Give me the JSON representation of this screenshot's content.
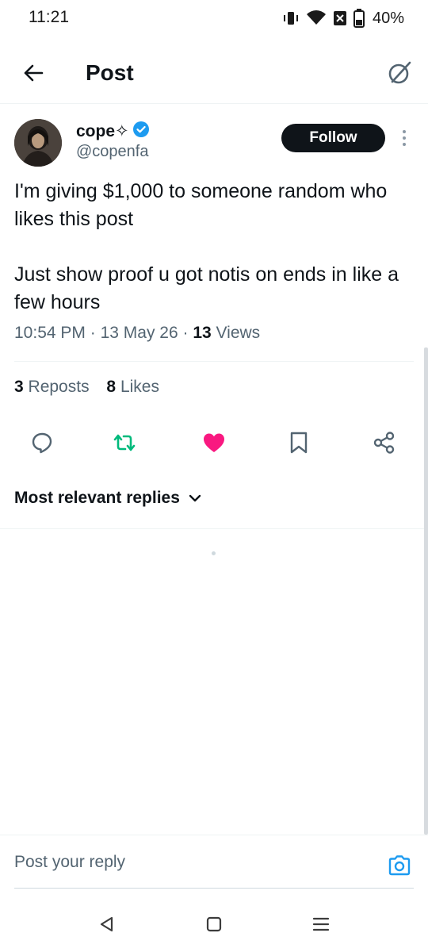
{
  "status_bar": {
    "time": "11:21",
    "battery": "40%",
    "icons": [
      "vibrate-icon",
      "wifi-icon",
      "no-sim-icon",
      "battery-icon"
    ]
  },
  "header": {
    "title": "Post",
    "back_icon": "arrow-left-icon",
    "grok_icon": "grok-icon"
  },
  "post": {
    "author": {
      "name": "cope✧",
      "handle": "@copenfa",
      "verified": true
    },
    "follow_label": "Follow",
    "text": "I'm giving $1,000 to someone random who likes this post\n\nJust show proof u got notis on ends in like a few hours",
    "time": "10:54 PM",
    "date": "13 May 26",
    "views_count": "13",
    "views_label": "Views",
    "separator": "·"
  },
  "stats": {
    "reposts_count": "3",
    "reposts_label": "Reposts",
    "likes_count": "8",
    "likes_label": "Likes"
  },
  "actions": {
    "icons": [
      "reply-icon",
      "repost-icon",
      "like-icon",
      "bookmark-icon",
      "share-icon"
    ],
    "like_active": true,
    "colors": {
      "repost": "#00ba7c",
      "like": "#f91880",
      "default": "#536471"
    }
  },
  "replies": {
    "filter_label": "Most relevant replies"
  },
  "reply_box": {
    "placeholder": "Post your reply",
    "camera_icon": "camera-icon",
    "accent": "#1d9bf0"
  },
  "nav": {
    "icons": [
      "back-triangle-icon",
      "home-square-icon",
      "menu-icon"
    ]
  }
}
